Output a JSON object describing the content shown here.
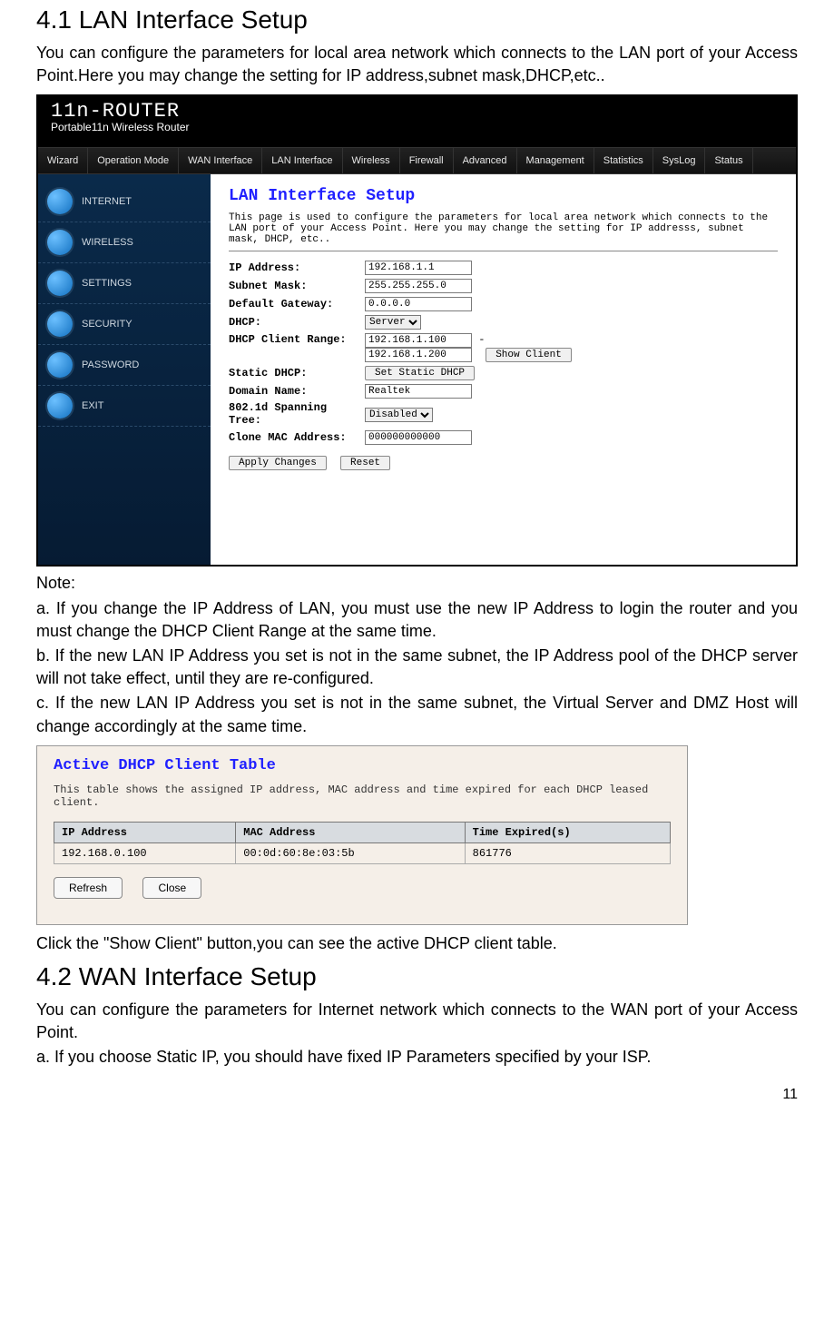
{
  "section41": {
    "heading": "4.1 LAN Interface Setup",
    "intro": "You can configure the parameters for local area network which connects to the LAN port of your Access Point.Here you may change the setting for IP address,subnet mask,DHCP,etc.."
  },
  "router": {
    "logo_top": "11n-ROUTER",
    "logo_sub": "Portable11n Wireless Router",
    "topnav": [
      "Wizard",
      "Operation Mode",
      "WAN Interface",
      "LAN Interface",
      "Wireless",
      "Firewall",
      "Advanced",
      "Management",
      "Statistics",
      "SysLog",
      "Status"
    ],
    "sidenav": [
      "INTERNET",
      "WIRELESS",
      "SETTINGS",
      "SECURITY",
      "PASSWORD",
      "EXIT"
    ],
    "main": {
      "title": "LAN Interface Setup",
      "desc": "This page is used to configure the parameters for local area network which connects to the LAN port of your Access Point. Here you may change the setting for IP addresss, subnet mask, DHCP, etc..",
      "ip_label": "IP Address:",
      "ip_value": "192.168.1.1",
      "mask_label": "Subnet Mask:",
      "mask_value": "255.255.255.0",
      "gw_label": "Default Gateway:",
      "gw_value": "0.0.0.0",
      "dhcp_label": "DHCP:",
      "dhcp_value": "Server",
      "range_label": "DHCP Client Range:",
      "range_start": "192.168.1.100",
      "range_dash": " - ",
      "range_end": "192.168.1.200",
      "show_client_btn": "Show Client",
      "static_label": "Static DHCP:",
      "static_btn": "Set Static DHCP",
      "domain_label": "Domain Name:",
      "domain_value": "Realtek",
      "stp_label": "802.1d Spanning Tree:",
      "stp_value": "Disabled",
      "clone_label": "Clone MAC Address:",
      "clone_value": "000000000000",
      "apply_btn": "Apply Changes",
      "reset_btn": "Reset"
    }
  },
  "notes": {
    "heading": "Note:",
    "a": "a. If you change the IP Address of LAN, you must use the new IP Address to login the router and you must change the DHCP Client Range at the same time.",
    "b": "b. If the new LAN IP Address you set is not in the same subnet, the IP Address pool of the DHCP server will not take effect, until they are re-configured.",
    "c": "c. If the new LAN IP Address you set is not in the same subnet, the Virtual Server and DMZ Host will change accordingly at the same time."
  },
  "dhcp_table": {
    "title": "Active DHCP Client Table",
    "desc": "This table shows the assigned IP address, MAC address and time expired for each DHCP leased client.",
    "cols": [
      "IP Address",
      "MAC Address",
      "Time Expired(s)"
    ],
    "rows": [
      {
        "ip": "192.168.0.100",
        "mac": "00:0d:60:8e:03:5b",
        "time": "861776"
      }
    ],
    "refresh_btn": "Refresh",
    "close_btn": "Close"
  },
  "after_table": "Click the \"Show Client\" button,you can see the active DHCP client table.",
  "section42": {
    "heading": "4.2 WAN Interface Setup",
    "p1": "You can configure the parameters for Internet network which connects to the WAN port of your Access Point.",
    "p2": "a. If you choose Static IP, you should have fixed IP Parameters specified by your   ISP."
  },
  "page_number": "11"
}
